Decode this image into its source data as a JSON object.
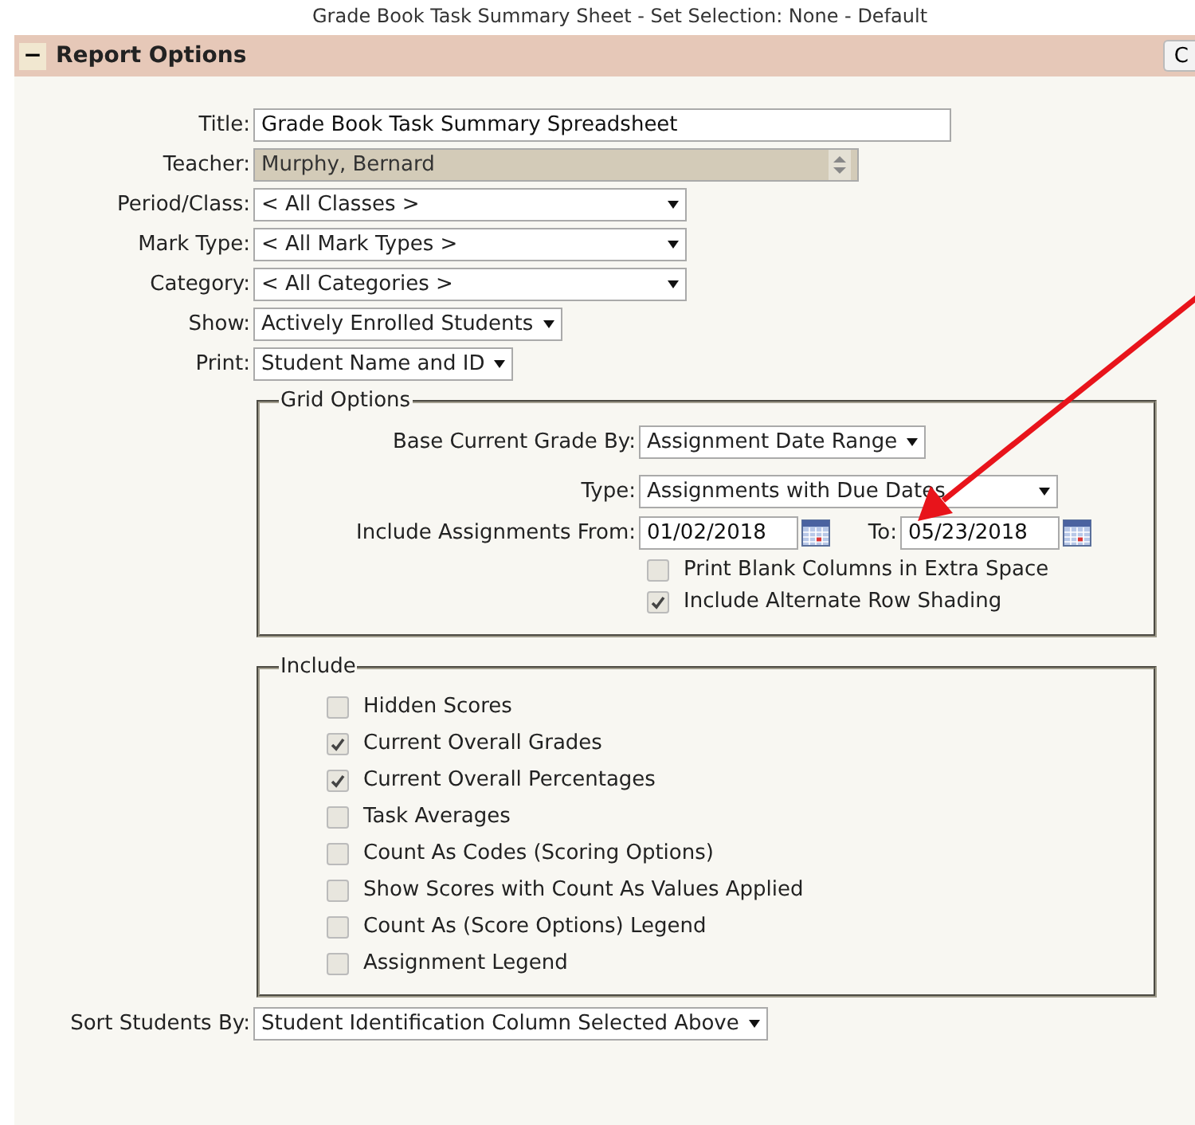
{
  "page_heading": "Grade Book Task Summary Sheet - Set Selection: None - Default",
  "section": {
    "toggle": "−",
    "title": "Report Options",
    "expanded": true,
    "side_button": "C"
  },
  "fields": [
    {
      "kind": "text",
      "label": "Title:",
      "value": "Grade Book Task Summary Spreadsheet",
      "disabled": false
    },
    {
      "kind": "spinner",
      "label": "Teacher:",
      "value": "Murphy, Bernard",
      "disabled": true
    },
    {
      "kind": "select-wide",
      "label": "Period/Class:",
      "value": "< All Classes >"
    },
    {
      "kind": "select-wide",
      "label": "Mark Type:",
      "value": "< All Mark Types >"
    },
    {
      "kind": "select-wide",
      "label": "Category:",
      "value": "< All Categories >"
    },
    {
      "kind": "select",
      "label": "Show:",
      "value": "Actively Enrolled Students"
    },
    {
      "kind": "select",
      "label": "Print:",
      "value": "Student Name and ID"
    }
  ],
  "grid_options": {
    "legend": "Grid Options",
    "base_grade": {
      "label": "Base Current Grade By:",
      "value": "Assignment Date Range"
    },
    "type": {
      "label": "Type:",
      "value": "Assignments with Due Dates"
    },
    "date_range": {
      "label": "Include Assignments From:",
      "from": "01/02/2018",
      "to_label": "To:",
      "to": "05/23/2018"
    },
    "checkboxes": [
      {
        "label": "Print Blank Columns in Extra Space",
        "checked": false
      },
      {
        "label": "Include Alternate Row Shading",
        "checked": true
      }
    ]
  },
  "include": {
    "legend": "Include",
    "checkboxes": [
      {
        "label": "Hidden Scores",
        "checked": false
      },
      {
        "label": "Current Overall Grades",
        "checked": true
      },
      {
        "label": "Current Overall Percentages",
        "checked": true
      },
      {
        "label": "Task Averages",
        "checked": false
      },
      {
        "label": "Count As Codes (Scoring Options)",
        "checked": false
      },
      {
        "label": "Show Scores with Count As Values Applied",
        "checked": false
      },
      {
        "label": "Count As (Score Options) Legend",
        "checked": false
      },
      {
        "label": "Assignment Legend",
        "checked": false
      }
    ]
  },
  "sort": {
    "label": "Sort Students By:",
    "value": "Student Identification Column Selected Above"
  }
}
